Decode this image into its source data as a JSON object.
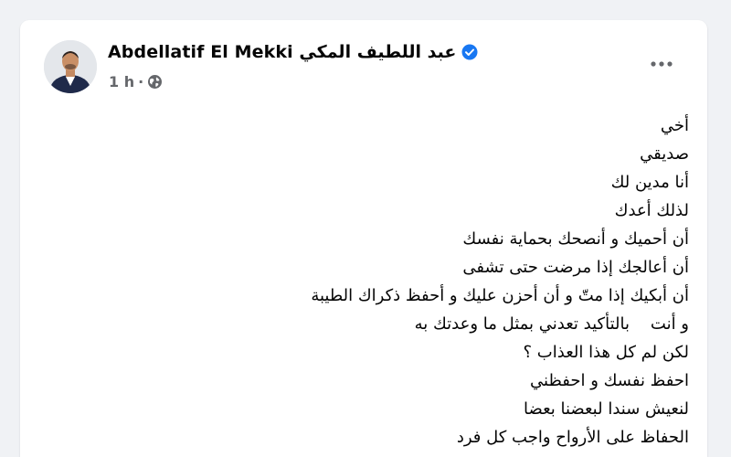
{
  "post": {
    "author": {
      "display_name": "Abdellatif El Mekki عبد اللطيف المكي",
      "verified_icon": "verified-badge-icon",
      "avatar_icon": "profile-avatar"
    },
    "meta": {
      "timestamp": "1 h",
      "separator": "·",
      "audience_icon": "globe-icon"
    },
    "menu_icon": "more-options-icon",
    "body_lines": [
      "أخي",
      "صديقي",
      "أنا مدين لك",
      "لذلك أعدك",
      "أن أحميك و أنصحك بحماية نفسك",
      "أن أعالجك إذا مرضت حتى تشفى",
      "أن أبكيك إذا متّ و أن أحزن عليك و أحفظ ذكراك الطيبة",
      "و أنت    بالتأكيد تعدني بمثل ما وعدتك به",
      "لكن لم كل هذا العذاب ؟",
      "احفظ نفسك و احفظني",
      "لنعيش سندا لبعضنا بعضا",
      "الحفاظ على الأرواح واجب كل فرد"
    ]
  },
  "colors": {
    "page_background": "#f0f2f5",
    "card_background": "#ffffff",
    "text_primary": "#050505",
    "text_secondary": "#65676b",
    "verified_blue": "#1877f2"
  }
}
